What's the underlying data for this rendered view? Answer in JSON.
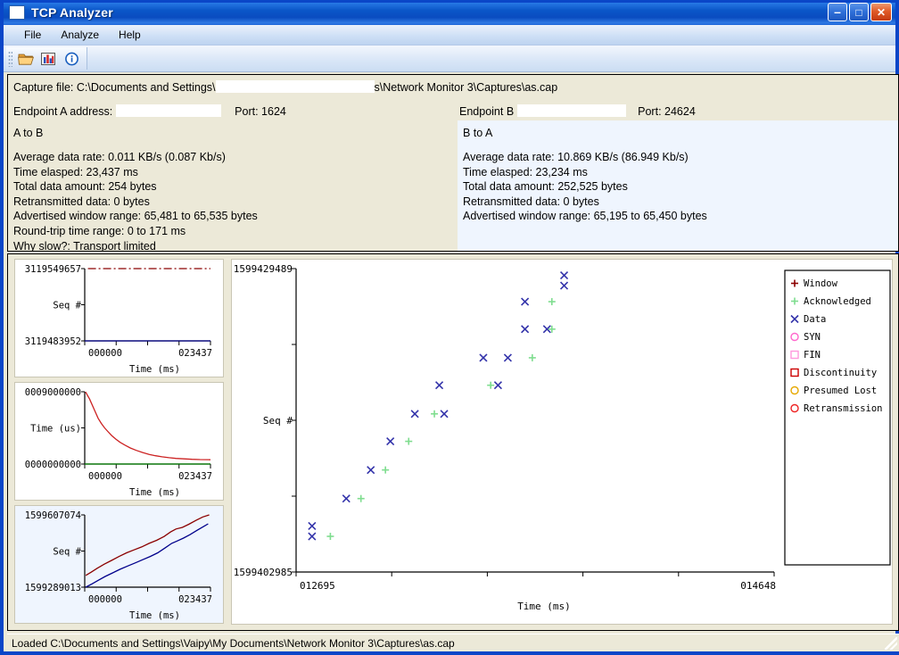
{
  "window": {
    "title": "TCP Analyzer",
    "icon": "app-window-icon",
    "buttons": {
      "minimize": "–",
      "maximize": "□",
      "close": "✕"
    }
  },
  "menubar": {
    "items": [
      {
        "label": "File"
      },
      {
        "label": "Analyze"
      },
      {
        "label": "Help"
      }
    ]
  },
  "toolbar": {
    "buttons": [
      {
        "icon": "open-folder-icon",
        "label": "Open"
      },
      {
        "icon": "bar-chart-icon",
        "label": "Analyze"
      },
      {
        "icon": "info-icon",
        "label": "About"
      }
    ]
  },
  "info": {
    "capture_prefix": "Capture file: C:\\Documents and Settings\\",
    "capture_suffix": "s\\Network Monitor 3\\Captures\\as.cap",
    "endpoint_a_label": "Endpoint A address:",
    "endpoint_a_port": "Port: 1624",
    "endpoint_b_label": "Endpoint B",
    "endpoint_b_port": "Port: 24624",
    "a_to_b": {
      "title": "A to B",
      "stats": [
        "Average data rate: 0.011 KB/s (0.087 Kb/s)",
        "Time elasped: 23,437 ms",
        "Total data amount: 254 bytes",
        "Retransmitted data: 0 bytes",
        "Advertised window range: 65,481 to 65,535 bytes",
        "Round-trip time range: 0 to 171 ms",
        "Why slow?: Transport limited"
      ]
    },
    "b_to_a": {
      "title": "B to A",
      "stats": [
        "Average data rate: 10.869 KB/s (86.949 Kb/s)",
        "Time elasped: 23,234 ms",
        "Total data amount: 252,525 bytes",
        "Retransmitted data: 0 bytes",
        "Advertised window range: 65,195 to 65,450 bytes"
      ]
    }
  },
  "statusbar": {
    "text": "Loaded C:\\Documents and Settings\\Vaipy\\My Documents\\Network Monitor 3\\Captures\\as.cap"
  },
  "colors": {
    "window_series": "#8b0000",
    "acknowledged_series": "#7fdd8f",
    "data_series": "#00008b",
    "syn": "#ff66cc",
    "fin": "#ff99dd",
    "discontinuity": "#cc0000",
    "presumed_lost": "#e6a800",
    "retransmission": "#ee2222",
    "green_line": "#008000",
    "red_curve": "#cc2222",
    "title_blue": "#0a56c8"
  },
  "chart_data": [
    {
      "id": "mini-seq-ab",
      "type": "line",
      "title": "",
      "xlabel": "Time (ms)",
      "ylabel": "Seq #",
      "ytick_top": "3119549657",
      "ytick_bottom": "3119483952",
      "xtick_left": "000000",
      "xtick_right": "023437",
      "ylim": [
        3119483952,
        3119549657
      ],
      "xlim": [
        0,
        23437
      ],
      "series": [
        {
          "name": "Window",
          "color": "#8b0000",
          "style": "dashdot",
          "x": [
            600,
            2400,
            3000,
            4000,
            5200,
            6000,
            7400,
            8400,
            9400,
            10600,
            12000,
            13400,
            14800,
            16400,
            18000,
            19600,
            21200,
            22600,
            23437
          ],
          "y": [
            3119549657,
            3119549657,
            3119549657,
            3119549657,
            3119549657,
            3119549657,
            3119549657,
            3119549657,
            3119549657,
            3119549657,
            3119549657,
            3119549657,
            3119549657,
            3119549657,
            3119549657,
            3119549657,
            3119549657,
            3119549657,
            3119549657
          ]
        },
        {
          "name": "Data",
          "color": "#00008b",
          "style": "solid",
          "x": [
            0,
            23437
          ],
          "y": [
            3119483952,
            3119483952
          ]
        }
      ]
    },
    {
      "id": "mini-rtt",
      "type": "line",
      "title": "",
      "xlabel": "Time (ms)",
      "ylabel": "Time (us)",
      "ytick_top": "0009000000",
      "ytick_bottom": "0000000000",
      "xtick_left": "000000",
      "xtick_right": "023437",
      "ylim": [
        0,
        9000000
      ],
      "xlim": [
        0,
        23437
      ],
      "series": [
        {
          "name": "Round-trip time",
          "color": "#cc2222",
          "style": "solid",
          "x": [
            150,
            900,
            1700,
            2500,
            3100,
            3700,
            4300,
            5000,
            5800,
            6600,
            7500,
            8500,
            9600,
            10800,
            12000,
            13200,
            14400,
            15700,
            17000,
            18500,
            20000,
            21500,
            23000,
            23437
          ],
          "y": [
            8980000,
            8100000,
            6900000,
            5700000,
            5050000,
            4500000,
            4050000,
            3550000,
            3100000,
            2700000,
            2350000,
            2000000,
            1700000,
            1430000,
            1200000,
            1030000,
            900000,
            790000,
            700000,
            640000,
            590000,
            560000,
            540000,
            535000
          ]
        },
        {
          "name": "baseline",
          "color": "#008000",
          "style": "solid",
          "x": [
            0,
            23437
          ],
          "y": [
            0,
            0
          ]
        }
      ]
    },
    {
      "id": "mini-seq-ba",
      "type": "line",
      "title": "",
      "xlabel": "Time (ms)",
      "ylabel": "Seq #",
      "ytick_top": "1599607074",
      "ytick_bottom": "1599289013",
      "xtick_left": "000000",
      "xtick_right": "023437",
      "ylim": [
        1599289013,
        1599607074
      ],
      "xlim": [
        0,
        23437
      ],
      "series": [
        {
          "name": "Window",
          "color": "#8b0000",
          "style": "solid",
          "x": [
            200,
            1200,
            2400,
            3600,
            5000,
            6400,
            7800,
            9200,
            10600,
            12000,
            13400,
            14800,
            16000,
            17000,
            18200,
            19400,
            20800,
            22000,
            23200
          ],
          "y": [
            1599341000,
            1599355000,
            1599373000,
            1599390000,
            1599407000,
            1599424000,
            1599440000,
            1599453000,
            1599466000,
            1599482000,
            1599495000,
            1599512000,
            1599532000,
            1599545000,
            1599552000,
            1599566000,
            1599584000,
            1599598000,
            1599607074
          ]
        },
        {
          "name": "Data",
          "color": "#00008b",
          "style": "solid",
          "x": [
            200,
            1400,
            2600,
            3800,
            5200,
            6600,
            8000,
            9400,
            10800,
            12200,
            13600,
            15000,
            16200,
            17200,
            18400,
            19600,
            21000,
            22200,
            23000
          ],
          "y": [
            1599289013,
            1599304000,
            1599320000,
            1599336000,
            1599352000,
            1599368000,
            1599382000,
            1599396000,
            1599410000,
            1599424000,
            1599440000,
            1599462000,
            1599482000,
            1599492000,
            1599505000,
            1599520000,
            1599540000,
            1599557000,
            1599568000
          ]
        }
      ]
    },
    {
      "id": "main-plot",
      "type": "scatter",
      "title": "",
      "xlabel": "Time (ms)",
      "ylabel": "Seq #",
      "ytick_top": "1599429489",
      "ytick_bottom": "1599402985",
      "xtick_left": "012695",
      "xtick_right": "014648",
      "ylim": [
        1599402985,
        1599429489
      ],
      "xlim": [
        12695,
        14648
      ],
      "grid": false,
      "legend_position": "right",
      "legend": [
        {
          "label": "Window",
          "marker": "plus",
          "color": "#8b0000"
        },
        {
          "label": "Acknowledged",
          "marker": "plus",
          "color": "#7fdd8f"
        },
        {
          "label": "Data",
          "marker": "cross",
          "color": "#3333aa"
        },
        {
          "label": "SYN",
          "marker": "circle",
          "color": "#ff66cc"
        },
        {
          "label": "FIN",
          "marker": "square",
          "color": "#ff99dd"
        },
        {
          "label": "Discontinuity",
          "marker": "square",
          "color": "#cc0000"
        },
        {
          "label": "Presumed Lost",
          "marker": "circle",
          "color": "#e6a800"
        },
        {
          "label": "Retransmission",
          "marker": "circle",
          "color": "#ee2222"
        }
      ],
      "series": [
        {
          "name": "Data",
          "marker": "cross",
          "color": "#3333aa",
          "points": [
            [
              12760,
              1599406100
            ],
            [
              12760,
              1599407000
            ],
            [
              12900,
              1599409400
            ],
            [
              13000,
              1599411900
            ],
            [
              13080,
              1599414400
            ],
            [
              13180,
              1599416800
            ],
            [
              13280,
              1599419300
            ],
            [
              13300,
              1599416800
            ],
            [
              13460,
              1599421700
            ],
            [
              13520,
              1599419300
            ],
            [
              13560,
              1599421700
            ],
            [
              13630,
              1599424200
            ],
            [
              13630,
              1599426600
            ],
            [
              13720,
              1599424200
            ],
            [
              13790,
              1599428000
            ],
            [
              13790,
              1599428900
            ]
          ]
        },
        {
          "name": "Acknowledged",
          "marker": "plus",
          "color": "#7fdd8f",
          "points": [
            [
              12835,
              1599406100
            ],
            [
              12960,
              1599409400
            ],
            [
              13060,
              1599411900
            ],
            [
              13155,
              1599414400
            ],
            [
              13260,
              1599416800
            ],
            [
              13490,
              1599419300
            ],
            [
              13660,
              1599421700
            ],
            [
              13740,
              1599424200
            ],
            [
              13740,
              1599426600
            ]
          ]
        }
      ]
    }
  ]
}
